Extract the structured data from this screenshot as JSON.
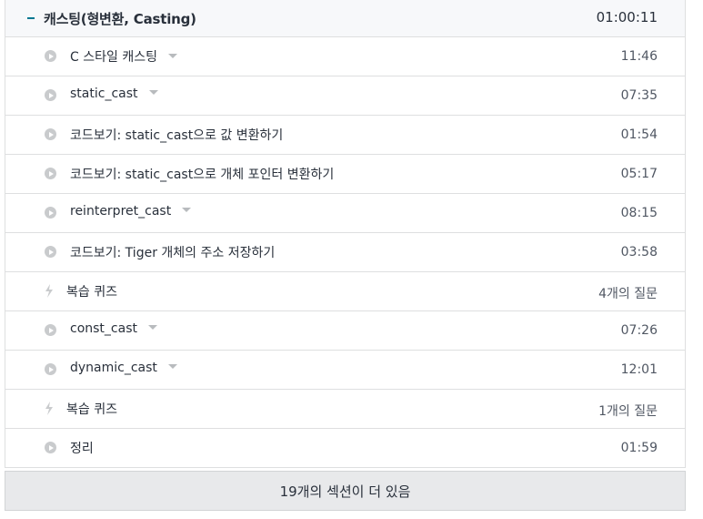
{
  "section": {
    "title": "캐스팅(형변환, Casting)",
    "duration": "01:00:11"
  },
  "items": [
    {
      "type": "video",
      "label": "C 스타일 캐스팅",
      "meta": "11:46",
      "has_dropdown": true
    },
    {
      "type": "video",
      "label": "static_cast",
      "meta": "07:35",
      "has_dropdown": true
    },
    {
      "type": "video",
      "label": "코드보기: static_cast으로 값 변환하기",
      "meta": "01:54",
      "has_dropdown": false
    },
    {
      "type": "video",
      "label": "코드보기: static_cast으로 개체 포인터 변환하기",
      "meta": "05:17",
      "has_dropdown": false
    },
    {
      "type": "video",
      "label": "reinterpret_cast",
      "meta": "08:15",
      "has_dropdown": true
    },
    {
      "type": "video",
      "label": "코드보기: Tiger 개체의 주소 저장하기",
      "meta": "03:58",
      "has_dropdown": false
    },
    {
      "type": "quiz",
      "label": "복습 퀴즈",
      "meta": "4개의 질문",
      "has_dropdown": false
    },
    {
      "type": "video",
      "label": "const_cast",
      "meta": "07:26",
      "has_dropdown": true
    },
    {
      "type": "video",
      "label": "dynamic_cast",
      "meta": "12:01",
      "has_dropdown": true
    },
    {
      "type": "quiz",
      "label": "복습 퀴즈",
      "meta": "1개의 질문",
      "has_dropdown": false
    },
    {
      "type": "video",
      "label": "정리",
      "meta": "01:59",
      "has_dropdown": false
    }
  ],
  "more_sections": "19개의 섹션이 더 있음",
  "icons": {
    "collapse": "minus-icon",
    "video": "play-circle-icon",
    "quiz": "lightning-bolt-icon",
    "dropdown": "caret-down-icon"
  },
  "colors": {
    "accent": "#007791",
    "icon_gray": "#c9cbcd",
    "header_bg": "#f7f8fa",
    "footer_bg": "#e8e9eb"
  }
}
